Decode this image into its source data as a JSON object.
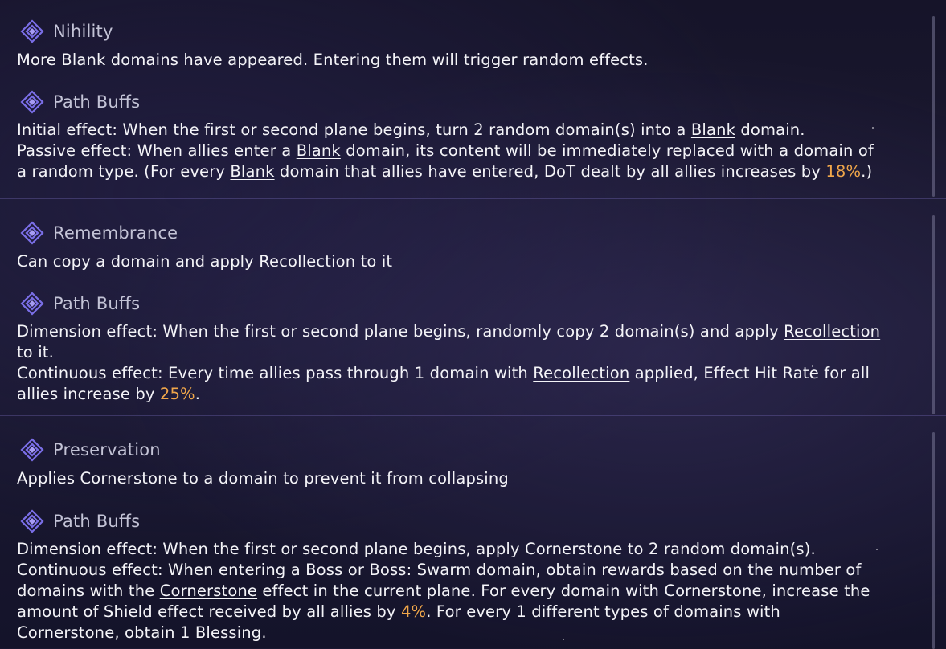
{
  "sections": [
    {
      "title": "Nihility",
      "description": "More Blank domains have appeared. Entering them will trigger random effects.",
      "buffs_title": "Path Buffs",
      "lines": [
        [
          {
            "t": "Initial effect: When the first or second plane begins, turn 2 random domain(s) into a "
          },
          {
            "t": "Blank",
            "k": "kw"
          },
          {
            "t": " domain."
          }
        ],
        [
          {
            "t": "Passive effect: When allies enter a "
          },
          {
            "t": "Blank",
            "k": "kw"
          },
          {
            "t": " domain, its content will be immediately replaced with a domain of"
          }
        ],
        [
          {
            "t": "a random type. (For every "
          },
          {
            "t": "Blank",
            "k": "kw"
          },
          {
            "t": " domain that allies have entered, DoT dealt by all allies increases by "
          },
          {
            "t": "18%",
            "k": "num"
          },
          {
            "t": ".)"
          }
        ]
      ]
    },
    {
      "title": "Remembrance",
      "description": "Can copy a domain and apply Recollection to it",
      "buffs_title": "Path Buffs",
      "lines": [
        [
          {
            "t": "Dimension effect: When the first or second plane begins, randomly copy 2 domain(s) and apply "
          },
          {
            "t": "Recollection",
            "k": "kw"
          }
        ],
        [
          {
            "t": "to it."
          }
        ],
        [
          {
            "t": "Continuous effect: Every time allies pass through 1 domain with "
          },
          {
            "t": "Recollection",
            "k": "kw"
          },
          {
            "t": " applied, Effect Hit Rate for all"
          }
        ],
        [
          {
            "t": "allies increase by "
          },
          {
            "t": "25%",
            "k": "num"
          },
          {
            "t": "."
          }
        ]
      ]
    },
    {
      "title": "Preservation",
      "description": "Applies Cornerstone to a domain to prevent it from collapsing",
      "buffs_title": "Path Buffs",
      "lines": [
        [
          {
            "t": "Dimension effect: When the first or second plane begins, apply "
          },
          {
            "t": "Cornerstone",
            "k": "kw"
          },
          {
            "t": " to 2 random domain(s)."
          }
        ],
        [
          {
            "t": "Continuous effect: When entering a "
          },
          {
            "t": "Boss",
            "k": "kw"
          },
          {
            "t": " or "
          },
          {
            "t": "Boss: Swarm",
            "k": "kw"
          },
          {
            "t": " domain, obtain rewards based on the number of"
          }
        ],
        [
          {
            "t": "domains with the "
          },
          {
            "t": "Cornerstone",
            "k": "kw"
          },
          {
            "t": " effect in the current plane. For every domain with Cornerstone, increase the"
          }
        ],
        [
          {
            "t": "amount of Shield effect received by all allies by "
          },
          {
            "t": "4%",
            "k": "num"
          },
          {
            "t": ". For every 1 different types of domains with"
          }
        ],
        [
          {
            "t": "Cornerstone, obtain 1 Blessing."
          }
        ]
      ]
    }
  ],
  "colors": {
    "accent": "#f0a64a",
    "icon": "#7b6fe8",
    "heading": "#c3c3d6"
  },
  "icon": "path-emblem-icon"
}
